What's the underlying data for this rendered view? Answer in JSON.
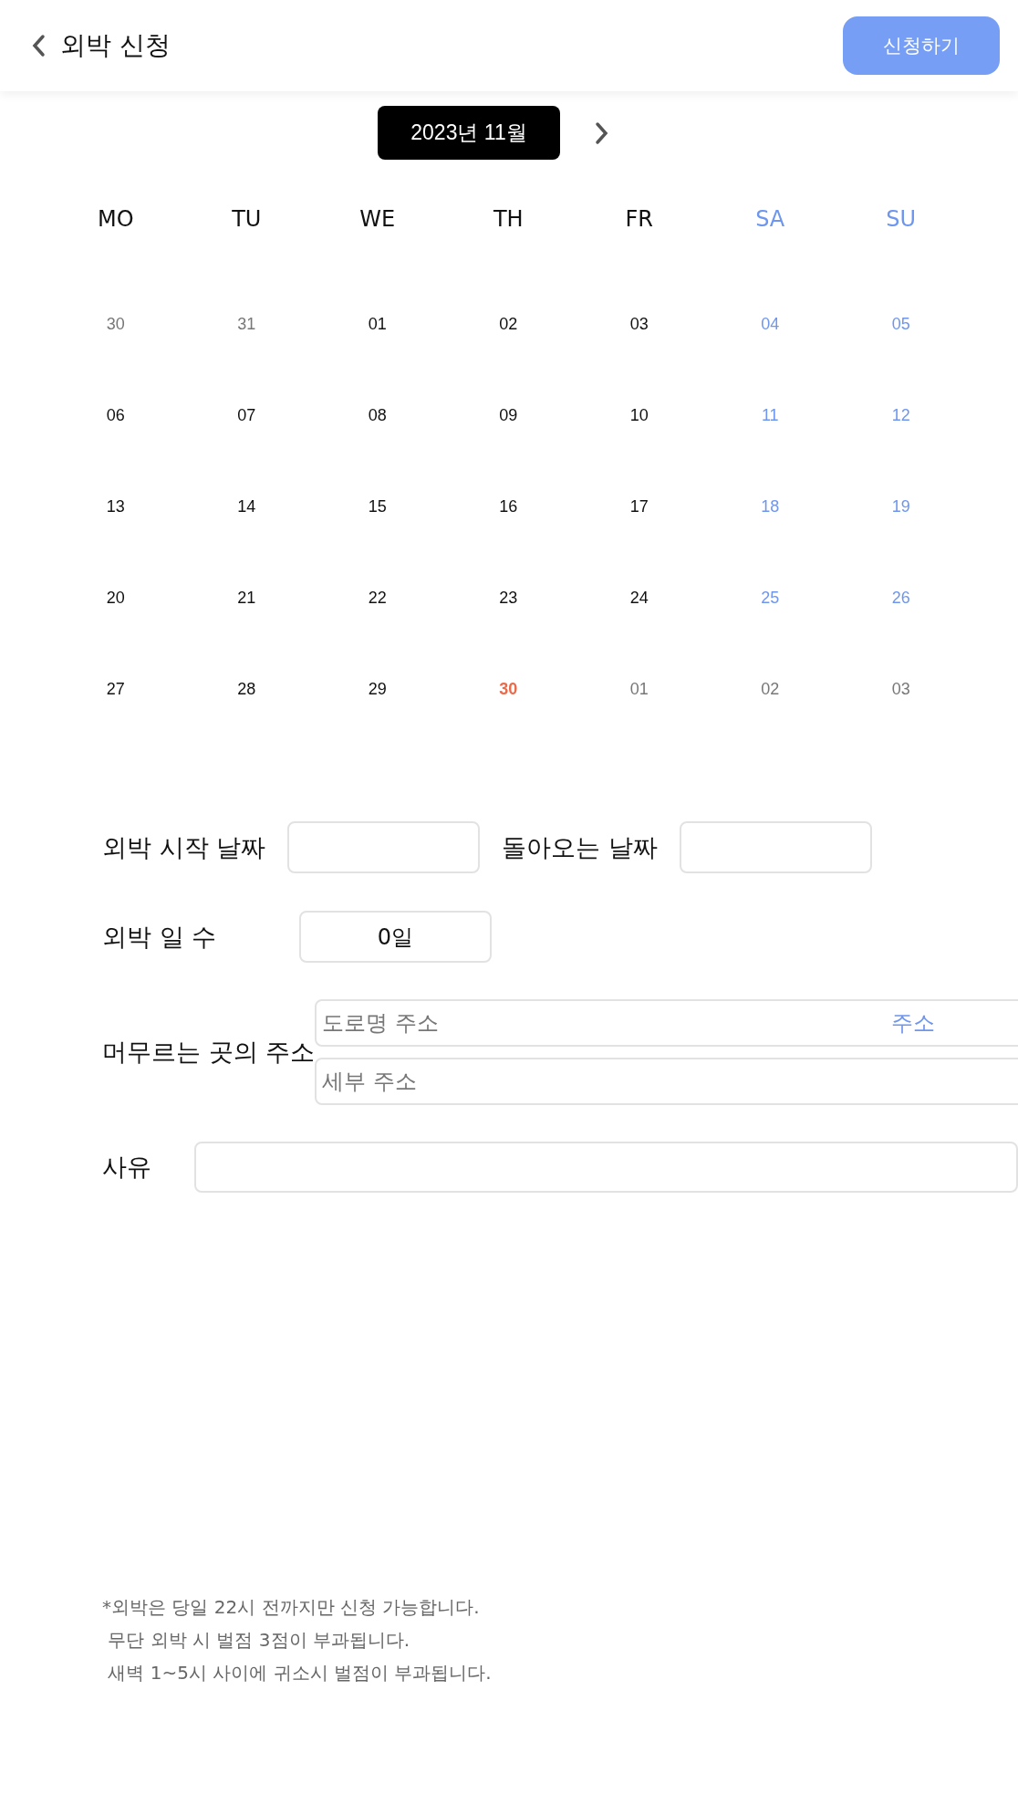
{
  "header": {
    "title": "외박 신청",
    "submit_button": "신청하기"
  },
  "calendar": {
    "month_label": "2023년 11월",
    "weekdays": [
      {
        "label": "MO",
        "kind": "weekday"
      },
      {
        "label": "TU",
        "kind": "weekday"
      },
      {
        "label": "WE",
        "kind": "weekday"
      },
      {
        "label": "TH",
        "kind": "weekday"
      },
      {
        "label": "FR",
        "kind": "weekday"
      },
      {
        "label": "SA",
        "kind": "weekend"
      },
      {
        "label": "SU",
        "kind": "weekend"
      }
    ],
    "weeks": [
      [
        {
          "label": "30",
          "kind": "outside"
        },
        {
          "label": "31",
          "kind": "outside"
        },
        {
          "label": "01",
          "kind": "normal"
        },
        {
          "label": "02",
          "kind": "normal"
        },
        {
          "label": "03",
          "kind": "normal"
        },
        {
          "label": "04",
          "kind": "weekend"
        },
        {
          "label": "05",
          "kind": "weekend"
        }
      ],
      [
        {
          "label": "06",
          "kind": "normal"
        },
        {
          "label": "07",
          "kind": "normal"
        },
        {
          "label": "08",
          "kind": "normal"
        },
        {
          "label": "09",
          "kind": "normal"
        },
        {
          "label": "10",
          "kind": "normal"
        },
        {
          "label": "11",
          "kind": "weekend"
        },
        {
          "label": "12",
          "kind": "weekend"
        }
      ],
      [
        {
          "label": "13",
          "kind": "normal"
        },
        {
          "label": "14",
          "kind": "normal"
        },
        {
          "label": "15",
          "kind": "normal"
        },
        {
          "label": "16",
          "kind": "normal"
        },
        {
          "label": "17",
          "kind": "normal"
        },
        {
          "label": "18",
          "kind": "weekend"
        },
        {
          "label": "19",
          "kind": "weekend"
        }
      ],
      [
        {
          "label": "20",
          "kind": "normal"
        },
        {
          "label": "21",
          "kind": "normal"
        },
        {
          "label": "22",
          "kind": "normal"
        },
        {
          "label": "23",
          "kind": "normal"
        },
        {
          "label": "24",
          "kind": "normal"
        },
        {
          "label": "25",
          "kind": "weekend"
        },
        {
          "label": "26",
          "kind": "weekend"
        }
      ],
      [
        {
          "label": "27",
          "kind": "normal"
        },
        {
          "label": "28",
          "kind": "normal"
        },
        {
          "label": "29",
          "kind": "normal"
        },
        {
          "label": "30",
          "kind": "today"
        },
        {
          "label": "01",
          "kind": "outside"
        },
        {
          "label": "02",
          "kind": "outside"
        },
        {
          "label": "03",
          "kind": "outside"
        }
      ]
    ]
  },
  "form": {
    "start_date": {
      "label": "외박 시작 날짜"
    },
    "return_date": {
      "label": "돌아오는 날짜"
    },
    "days": {
      "label": "외박 일 수",
      "value": "0일"
    },
    "address": {
      "label": "머무르는 곳의 주소",
      "road_placeholder": "도로명 주소",
      "search_link": "주소",
      "detail_placeholder": "세부 주소"
    },
    "reason": {
      "label": "사유"
    }
  },
  "notes": [
    "*외박은 당일 22시 전까지만 신청 가능합니다.",
    " 무단 외박 시 벌점 3점이 부과됩니다.",
    " 새벽 1~5시 사이에 귀소시 벌점이 부과됩니다."
  ]
}
